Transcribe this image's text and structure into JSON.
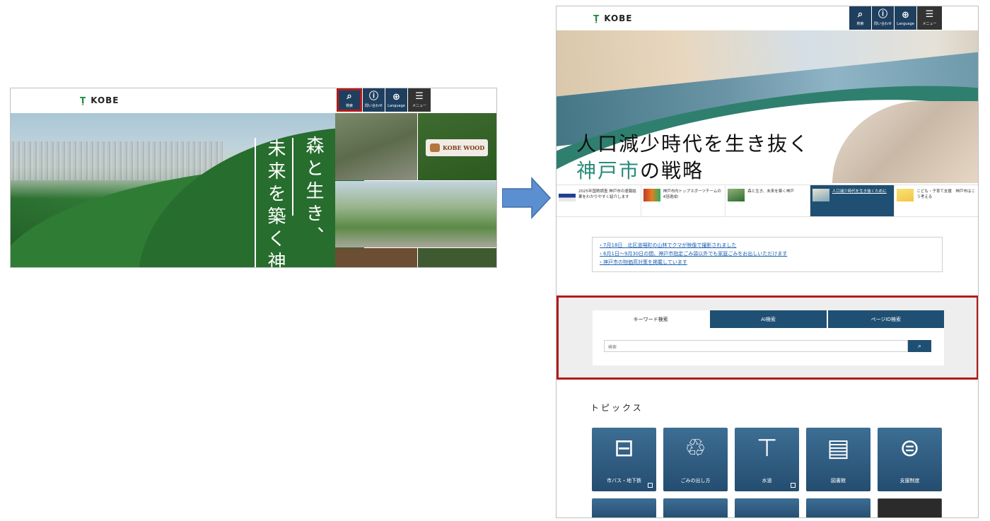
{
  "left": {
    "logo": "KOBE",
    "header_buttons": [
      {
        "label": "検索",
        "icon": "search-icon"
      },
      {
        "label": "問い合わせ",
        "icon": "question-icon"
      },
      {
        "label": "Language",
        "icon": "globe-icon"
      },
      {
        "label": "メニュー",
        "icon": "hamburger-icon"
      }
    ],
    "hero_text_1": "森と生き、",
    "hero_text_2": "未来を築く神",
    "kobe_wood": "KOBE WOOD"
  },
  "right": {
    "logo": "KOBE",
    "header_buttons": [
      {
        "label": "検索",
        "icon": "search-icon"
      },
      {
        "label": "問い合わせ",
        "icon": "question-icon"
      },
      {
        "label": "Language",
        "icon": "globe-icon"
      },
      {
        "label": "メニュー",
        "icon": "hamburger-icon"
      }
    ],
    "hero_title_line1": "人口減少時代を生き抜く",
    "hero_title_line2_accent": "神戸市",
    "hero_title_line2_rest": "の戦略",
    "feature_cards": [
      {
        "text": "2025年国勢調査 神戸市の速報結果をわかりやすく紹介します"
      },
      {
        "text": "神戸市内トップスポーツチームの4冠達成!"
      },
      {
        "text": "森と生き、未来を築く神戸"
      },
      {
        "text": "人口減少時代を生き抜くために"
      },
      {
        "text": "こども・子育て支援　神戸市はこう考える"
      }
    ],
    "notices": [
      "7月18日　北区道場町の山林でクマが映像で撮影されました",
      "6月1日～9月30日の間、神戸市指定ごみ袋以外でも家庭ごみをお出しいただけます",
      "神戸市の物価高対策を掲載しています"
    ],
    "search": {
      "tabs": [
        "キーワード検索",
        "AI検索",
        "ページID検索"
      ],
      "placeholder": "検索"
    },
    "topics_title": "トピックス",
    "topics": [
      {
        "label": "市バス・地下鉄",
        "icon": "bus-icon"
      },
      {
        "label": "ごみの出し方",
        "icon": "trash-icon"
      },
      {
        "label": "水道",
        "icon": "faucet-icon"
      },
      {
        "label": "図書館",
        "icon": "book-icon"
      },
      {
        "label": "支援制度",
        "icon": "document-search-icon"
      }
    ]
  },
  "colors": {
    "accent_red": "#b31b1b",
    "navy": "#1f4f73",
    "kobe_green": "#1a8a3c",
    "teal": "#2a8a7a"
  }
}
